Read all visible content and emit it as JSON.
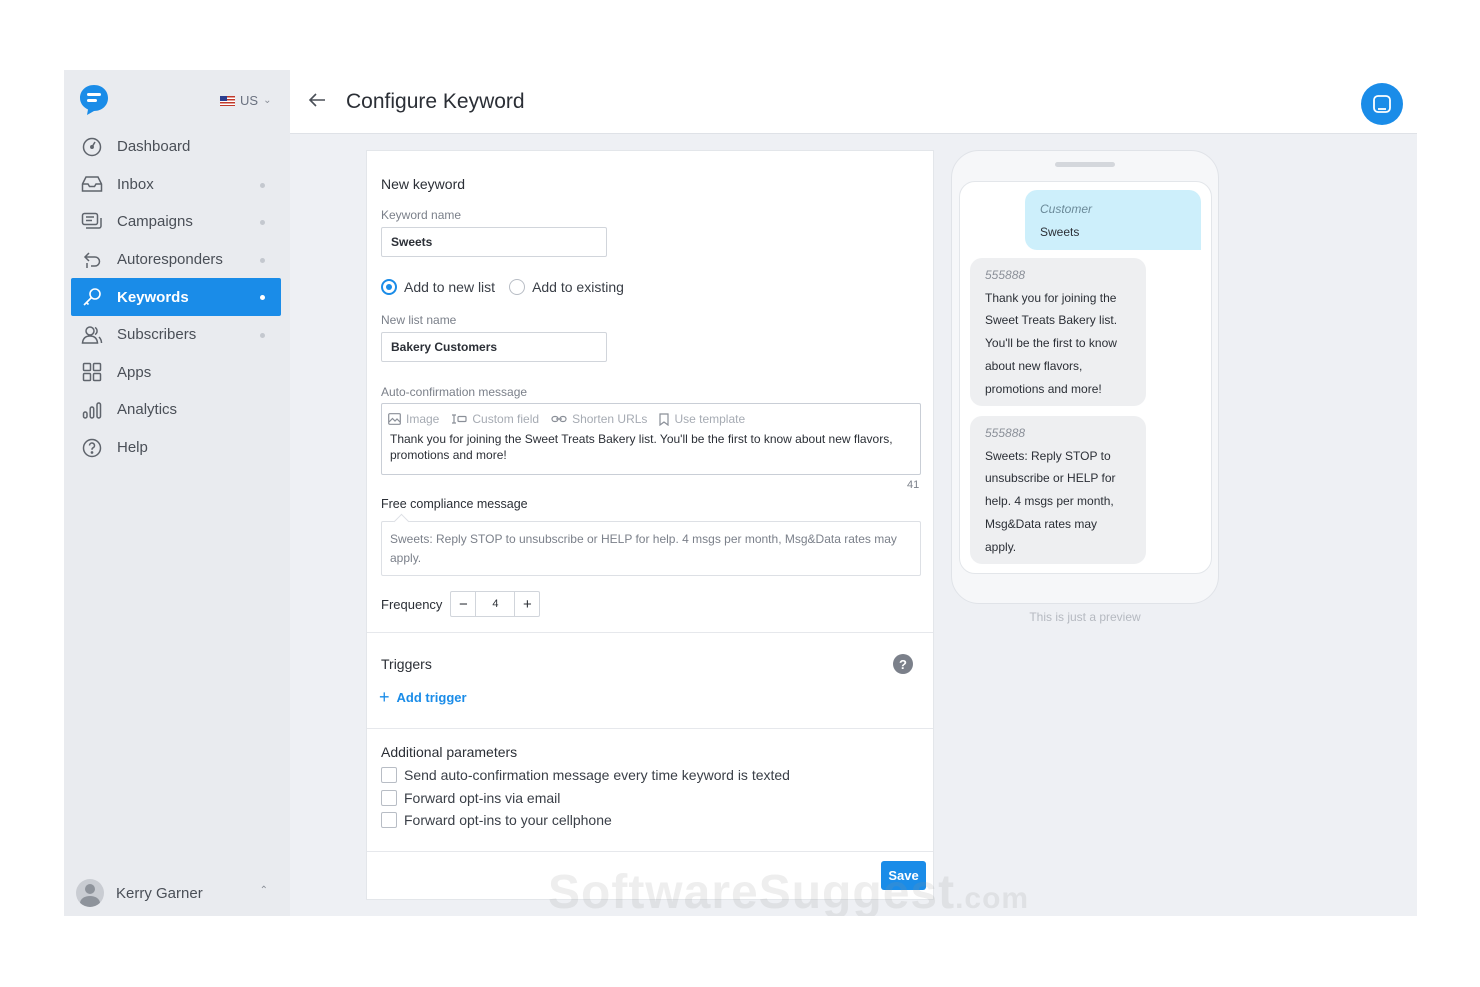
{
  "sidebar": {
    "country": "US",
    "items": [
      {
        "label": "Dashboard"
      },
      {
        "label": "Inbox"
      },
      {
        "label": "Campaigns"
      },
      {
        "label": "Autoresponders"
      },
      {
        "label": "Keywords"
      },
      {
        "label": "Subscribers"
      },
      {
        "label": "Apps"
      },
      {
        "label": "Analytics"
      },
      {
        "label": "Help"
      }
    ],
    "active": "Keywords",
    "user_name": "Kerry Garner"
  },
  "header": {
    "title": "Configure Keyword"
  },
  "form": {
    "section_title": "New keyword",
    "keyword_name_label": "Keyword name",
    "keyword_name_value": "Sweets",
    "radio_new": "Add to new list",
    "radio_existing": "Add to existing",
    "radio_selected": "Add to new list",
    "list_name_label": "New list name",
    "list_name_value": "Bakery Customers",
    "auto_conf_label": "Auto-confirmation message",
    "toolbar": {
      "image": "Image",
      "custom_field": "Custom field",
      "shorten_urls": "Shorten URLs",
      "use_template": "Use template"
    },
    "auto_conf_text": "Thank you for joining the Sweet Treats Bakery list. You'll be the first to know about new flavors, promotions and more!",
    "char_counter": "41",
    "compliance_label": "Free compliance message",
    "compliance_text": "Sweets: Reply STOP to unsubscribe or HELP for help. 4 msgs per month, Msg&Data rates may apply.",
    "frequency_label": "Frequency",
    "frequency_value": "4",
    "triggers_title": "Triggers",
    "add_trigger": "Add trigger",
    "params_title": "Additional parameters",
    "params": [
      {
        "label": "Send auto-confirmation message every time keyword is texted",
        "checked": false
      },
      {
        "label": "Forward opt-ins via email",
        "checked": false
      },
      {
        "label": "Forward opt-ins to your cellphone",
        "checked": false
      }
    ],
    "save_label": "Save"
  },
  "preview": {
    "customer_label": "Customer",
    "customer_text": "Sweets",
    "reply1_sender": "555888",
    "reply1_text": "Thank you for joining the Sweet Treats Bakery list. You'll be the first to know about new flavors, promotions and more!",
    "reply2_sender": "555888",
    "reply2_text": "Sweets: Reply STOP to unsubscribe or HELP for help. 4 msgs per month, Msg&Data rates may apply.",
    "note": "This is just a preview"
  },
  "watermark": {
    "main": "SoftwareSuggest",
    "suffix": ".com"
  },
  "colors": {
    "accent": "#1a8ce8",
    "sidebar_bg": "#e9ebef",
    "customer_bubble": "#cdeffb"
  }
}
